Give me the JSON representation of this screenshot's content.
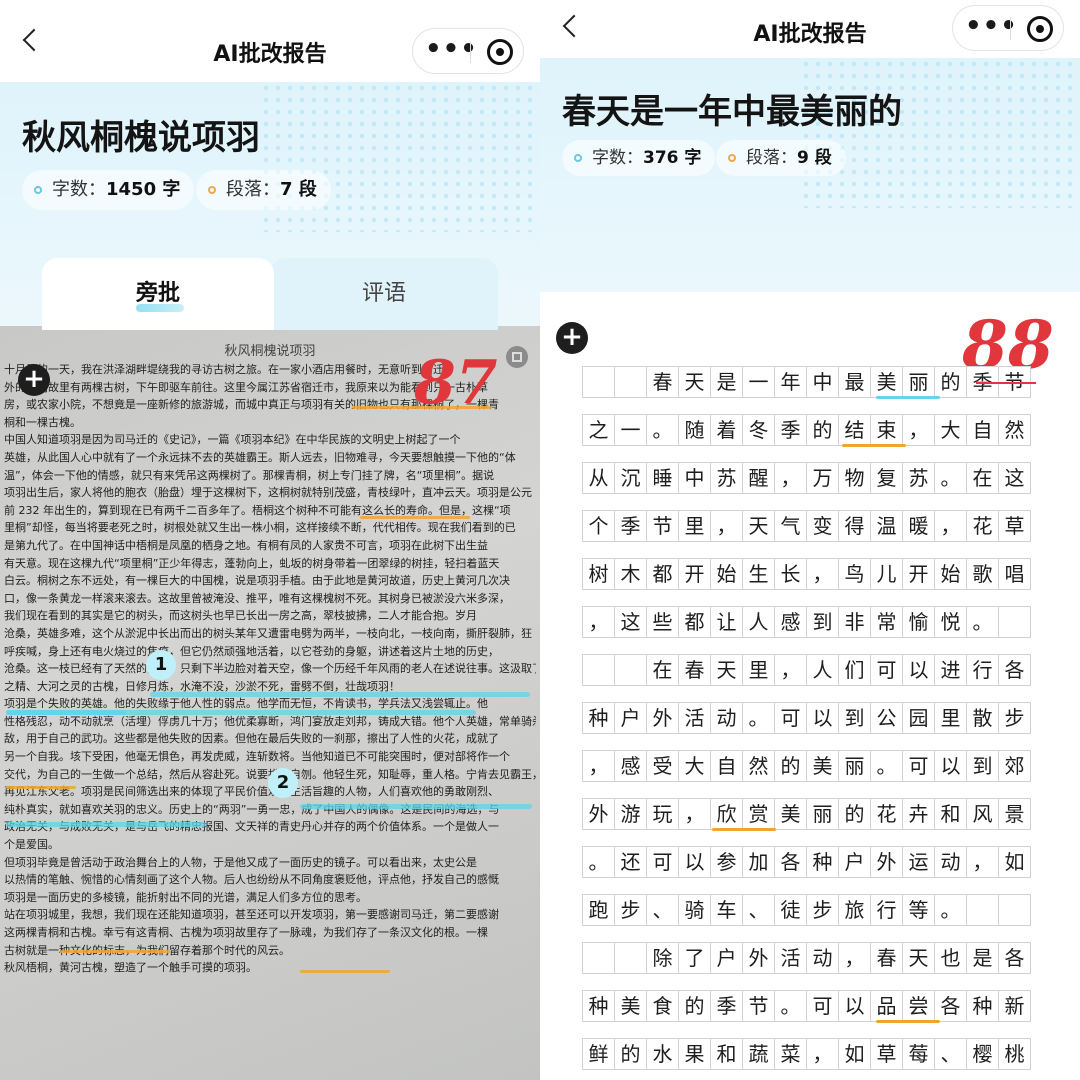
{
  "left": {
    "nav": {
      "title": "AI批改报告",
      "more_icon": "•••"
    },
    "essay": {
      "title": "秋风桐槐说项羽",
      "words_label": "字数：",
      "words_value": "1450 字",
      "paras_label": "段落：",
      "paras_value": "7 段"
    },
    "tabs": [
      {
        "label": "旁批",
        "active": true
      },
      {
        "label": "评语",
        "active": false
      }
    ],
    "photo": {
      "header": "秋风桐槐说项羽",
      "score": "87",
      "markers": [
        "1",
        "2"
      ],
      "plus": "+",
      "lines": [
        "十月里的一天，我在洪泽湖畔堤绕我的寻访古树之旅。在一家小酒店用餐时，无意听到宿迁",
        "外的项羽故里有两棵古树，下午即驱车前往。这里今属江苏省宿迁市，我原来以为能看到只一古朴草",
        "房，或农家小院，不想竟是一座新修的旅游城，而城中真正与项羽有关的旧物也只有那棵桐了，一棵青",
        "桐和一棵古槐。",
        "中国人知道项羽是因为司马迁的《史记》，一篇《项羽本纪》在中华民族的文明史上树起了一个",
        "英雄，从此国人心中就有了一个永远抹不去的英雄霸王。斯人远去，旧物难寻，今天要想触摸一下他的“体",
        "温”，体会一下他的情感，就只有来凭吊这两棵树了。那棵青桐，树上专门挂了牌，名“项里桐”。据说",
        "项羽出生后，家人将他的胞衣（胎盘）埋于这棵树下，这桐树就特别茂盛，青枝绿叶，直冲云天。项羽是公元",
        "前 232 年出生的，算到现在已有两千二百多年了。梧桐这个树种不可能有这么长的寿命。但是，这棵“项",
        "里桐”却怪，每当将要老死之时，树根处就又生出一株小桐，这样接续不断，代代相传。现在我们看到的已",
        "是第九代了。在中国神话中梧桐是凤凰的栖身之地。有桐有凤的人家贵不可言，项羽在此树下出生益",
        "有天意。现在这棵九代“项里桐”正少年得志，蓬勃向上，虬坂的树身带着一团翠绿的树挂，轻扫着蓝天",
        "白云。桐树之东不远处，有一棵巨大的中国槐，说是项羽手植。由于此地是黄河故道，历史上黄河几次决",
        "口，像一条黄龙一样滚来滚去。这故里曾被淹没、推平，唯有这棵槐树不死。其树身已被淤没六米多深，",
        "我们现在看到的其实是它的树头，而这树头也早已长出一房之高，翠枝披拂，二人才能合抱。岁月",
        "沧桑，英雄多难，这个从淤泥中长出而出的树头某年又遭雷电劈为两半，一枝向北，一枝向南，撕肝裂肺，狂",
        "呼疾喊，身上还有电火烧过的焦痕，但它仍然顽强地活着，以它苍劲的身躯，讲述着这片土地的历史，",
        "沧桑。这一枝已经有了天然的姿态，只剩下半边脸对着天空，像一个历经千年风雨的老人在述说往事。这汲取了天地",
        "之精、大河之灵的古槐，日修月炼，水淹不没，沙淤不死，雷劈不倒，壮哉项羽！",
        "项羽是个失败的英雄。他的失败缘于他人性的弱点。他学而无恒，不肯读书，学兵法又浅尝辄止。他",
        "性格残忍，动不动就烹（活埋）俘虏几十万；他优柔寡断，鸿门宴放走刘邦，铸成大错。他个人英雄，常单骑杀",
        "敌，用于自己的武功。这些都是他失败的因素。但他在最后失败的一刹那，擦出了人性的火花，成就了",
        "另一个自我。垓下受困，他毫无惧色，再发虎威，连斩数将。当他知道已不可能突围时，便对部将作一个",
        "交代，为自己的一生做一个总结，然后从容赴死。说要拔剑自刎。他轻生死，知耻辱，重人格。宁肯去见霸王，也羞于",
        "再见江东父老。项羽是民间筛选出来的体现了平民价值观和生活旨趣的人物，人们喜欢他的勇敢刚烈、",
        "纯朴真实，就如喜欢关羽的忠义。历史上的“两羽”一勇一忠，成了中国人的偶像。这是民间的海选，与",
        "政治无关，与成败无关，是与岳飞的精忠报国、文天祥的青史丹心并存的两个价值体系。一个是做人一",
        "个是爱国。",
        "但项羽毕竟是曾活动于政治舞台上的人物，于是他又成了一面历史的镜子。可以看出来，太史公是",
        "以热情的笔触、惋惜的心情刻画了这个人物。后人也纷纷从不同角度褒贬他，评点他，抒发自己的感慨",
        "项羽是一面历史的多棱镜，能折射出不同的光谱，满足人们多方位的思考。",
        "站在项羽城里，我想，我们现在还能知道项羽，甚至还可以开发项羽，第一要感谢司马迁，第二要感谢",
        "这两棵青桐和古槐。幸亏有这青桐、古槐为项羽故里存了一脉魂，为我们存了一条汉文化的根。一棵",
        "古树就是一种文化的标志，为我们留存着那个时代的风云。",
        "秋风梧桐，黄河古槐，塑造了一个触手可摸的项羽。"
      ]
    }
  },
  "right": {
    "nav": {
      "title": "AI批改报告",
      "more_icon": "•••"
    },
    "essay": {
      "title": "春天是一年中最美丽的",
      "words_label": "字数：",
      "words_value": "376 字",
      "paras_label": "段落：",
      "paras_value": "9 段"
    },
    "tabs": [
      {
        "label": "旁批",
        "active": true
      },
      {
        "label": "评语",
        "active": false
      }
    ],
    "score": "88",
    "plus": "+",
    "grid_rows": [
      "  春天是一年中最美丽的季节",
      "之一。随着冬季的结束，大自然",
      "从沉睡中苏醒，万物复苏。在这",
      "个季节里，天气变得温暖，花草",
      "树木都开始生长，鸟儿开始歌唱",
      "，这些都让人感到非常愉悦。 ",
      "  在春天里，人们可以进行各",
      "种户外活动。可以到公园里散步",
      "，感受大自然的美丽。可以到郊",
      "外游玩，欣赏美丽的花卉和风景",
      "。还可以参加各种户外运动，如",
      "跑步、骑车、徒步旅行等。  ",
      "  除了户外活动，春天也是各",
      "种美食的季节。可以品尝各种新",
      "鲜的水果和蔬菜，如草莓、樱桃"
    ]
  }
}
